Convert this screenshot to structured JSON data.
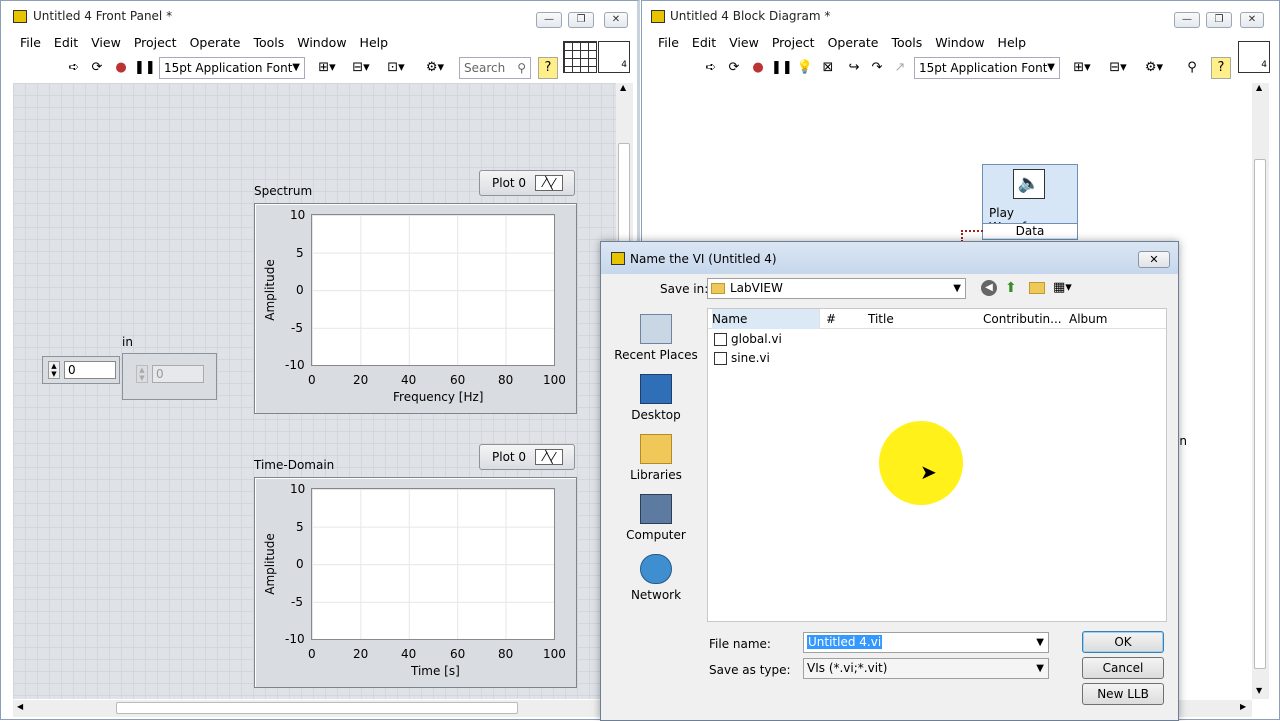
{
  "front_panel": {
    "title": "Untitled 4 Front Panel *",
    "menu": [
      "File",
      "Edit",
      "View",
      "Project",
      "Operate",
      "Tools",
      "Window",
      "Help"
    ],
    "font": "15pt Application Font",
    "search_placeholder": "Search",
    "control_label": "in",
    "control_value": "0",
    "indicator_value": "0",
    "spectrum": {
      "title": "Spectrum",
      "legend": "Plot 0",
      "ylabel": "Amplitude",
      "xlabel": "Frequency [Hz]",
      "yticks": [
        "10",
        "5",
        "0",
        "-5",
        "-10"
      ],
      "xticks": [
        "0",
        "20",
        "40",
        "60",
        "80",
        "100"
      ]
    },
    "time_domain": {
      "title": "Time-Domain",
      "legend": "Plot 0",
      "ylabel": "Amplitude",
      "xlabel": "Time [s]",
      "yticks": [
        "10",
        "5",
        "0",
        "-5",
        "-10"
      ],
      "xticks": [
        "0",
        "20",
        "40",
        "60",
        "80",
        "100"
      ]
    }
  },
  "block_diagram": {
    "title": "Untitled 4 Block Diagram *",
    "menu": [
      "File",
      "Edit",
      "View",
      "Project",
      "Operate",
      "Tools",
      "Window",
      "Help"
    ],
    "font": "15pt Application Font",
    "node_title": "Play Waveform",
    "node_terminal": "Data",
    "partial_label": "nain"
  },
  "dialog": {
    "title": "Name the VI (Untitled 4)",
    "save_in_label": "Save in:",
    "save_in_value": "LabVIEW",
    "places": [
      "Recent Places",
      "Desktop",
      "Libraries",
      "Computer",
      "Network"
    ],
    "columns": [
      "Name",
      "#",
      "Title",
      "Contributin...",
      "Album"
    ],
    "files": [
      "global.vi",
      "sine.vi"
    ],
    "file_name_label": "File name:",
    "file_name_value": "Untitled 4.vi",
    "save_type_label": "Save as type:",
    "save_type_value": "VIs (*.vi;*.vit)",
    "ok": "OK",
    "cancel": "Cancel",
    "new_llb": "New LLB"
  }
}
